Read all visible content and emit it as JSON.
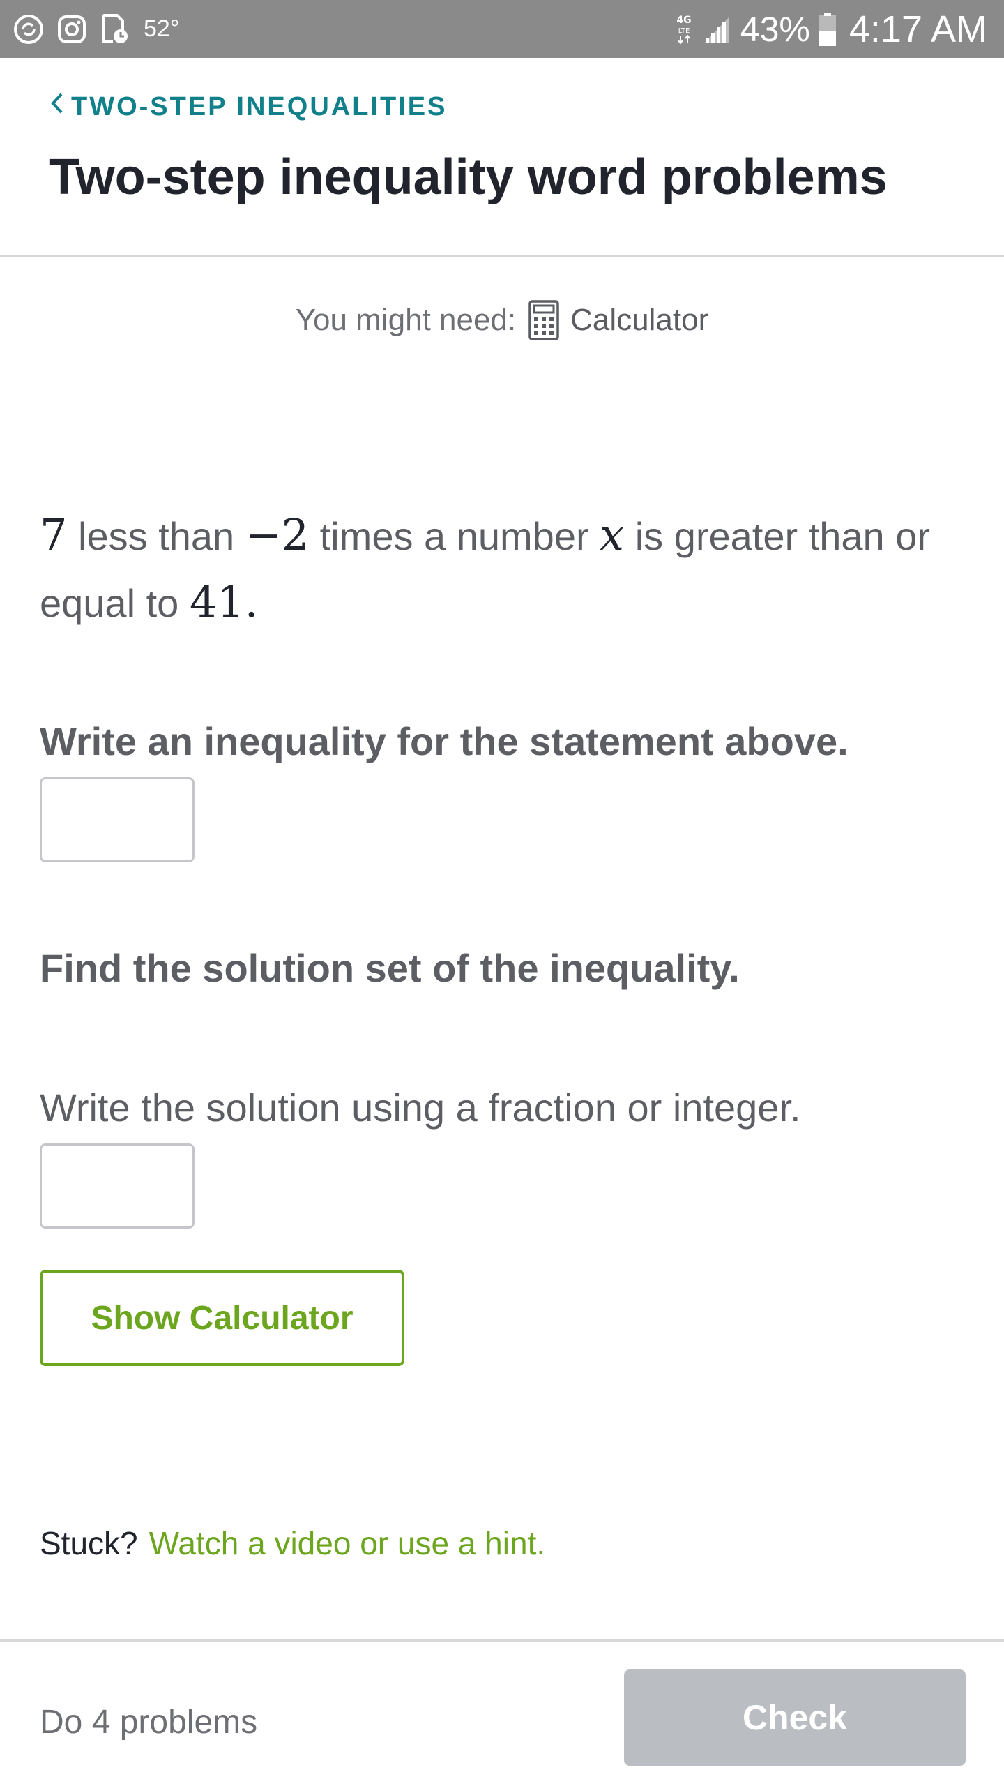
{
  "status_bar": {
    "temperature": "52°",
    "network_type": "4G LTE",
    "battery_percent": "43%",
    "time": "4:17 AM"
  },
  "header": {
    "breadcrumb": "TWO-STEP INEQUALITIES",
    "title": "Two-step inequality word problems"
  },
  "tools": {
    "label": "You might need:",
    "tool_name": "Calculator",
    "icon": "calculator-icon"
  },
  "problem": {
    "n1": "7",
    "t1": " less than ",
    "n2": "−2",
    "t2": " times a number ",
    "var": "x",
    "t3": " is greater than or equal to ",
    "n3": "41",
    "t4": "."
  },
  "question1": {
    "prompt": "Write an inequality for the statement above.",
    "value": ""
  },
  "question2": {
    "prompt": "Find the solution set of the inequality.",
    "instruction": "Write the solution using a fraction or integer.",
    "value": ""
  },
  "show_calculator_label": "Show Calculator",
  "help": {
    "stuck_label": "Stuck?",
    "hint_link": "Watch a video or use a hint."
  },
  "footer": {
    "progress_text": "Do 4 problems",
    "check_label": "Check"
  },
  "colors": {
    "status_bar": "#8a8a8a",
    "breadcrumb": "#11808a",
    "accent_green": "#6ca51e",
    "check_disabled": "#babec2"
  }
}
